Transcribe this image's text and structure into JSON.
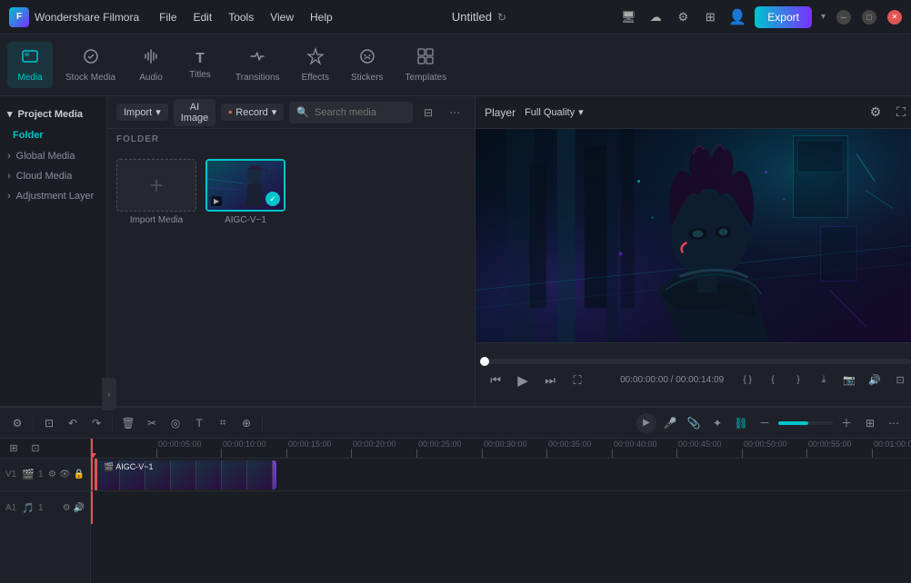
{
  "app": {
    "name": "Wondershare Filmora",
    "logo_letters": "F",
    "doc_title": "Untitled"
  },
  "menu": {
    "items": [
      "File",
      "Edit",
      "Tools",
      "View",
      "Help"
    ]
  },
  "toolbar": {
    "items": [
      {
        "id": "media",
        "label": "Media",
        "icon": "🖼",
        "active": true
      },
      {
        "id": "stock",
        "label": "Stock Media",
        "icon": "🎬",
        "active": false
      },
      {
        "id": "audio",
        "label": "Audio",
        "icon": "♪",
        "active": false
      },
      {
        "id": "titles",
        "label": "Titles",
        "icon": "T",
        "active": false
      },
      {
        "id": "transitions",
        "label": "Transitions",
        "icon": "⟷",
        "active": false
      },
      {
        "id": "effects",
        "label": "Effects",
        "icon": "✦",
        "active": false
      },
      {
        "id": "stickers",
        "label": "Stickers",
        "icon": "★",
        "active": false
      },
      {
        "id": "templates",
        "label": "Templates",
        "icon": "⊞",
        "active": false
      }
    ],
    "export_label": "Export"
  },
  "sidebar": {
    "project_media_label": "Project Media",
    "items": [
      {
        "id": "folder",
        "label": "Folder",
        "active": true
      },
      {
        "id": "global",
        "label": "Global Media",
        "active": false
      },
      {
        "id": "cloud",
        "label": "Cloud Media",
        "active": false
      },
      {
        "id": "adjustment",
        "label": "Adjustment Layer",
        "active": false
      }
    ]
  },
  "media_panel": {
    "import_label": "Import",
    "ai_image_label": "AI Image",
    "record_label": "Record",
    "search_placeholder": "Search media",
    "folder_section": "FOLDER",
    "items": [
      {
        "id": "import",
        "label": "Import Media",
        "type": "add"
      },
      {
        "id": "aigc-v-1",
        "label": "AIGC-V~1",
        "type": "video",
        "selected": true
      }
    ]
  },
  "player": {
    "label": "Player",
    "quality": "Full Quality",
    "current_time": "00:00:00:00",
    "total_time": "00:00:14:09",
    "separator": " / "
  },
  "timeline": {
    "tracks": [
      {
        "id": "video1",
        "type": "video",
        "num": "1",
        "clip": "AIGC-V~1",
        "start_pct": "0",
        "width_pct": "29"
      },
      {
        "id": "audio1",
        "type": "audio",
        "num": "1"
      }
    ],
    "ruler_times": [
      "00:00:05:00",
      "00:00:10:00",
      "00:00:15:00",
      "00:00:20:00",
      "00:00:25:00",
      "00:00:30:00",
      "00:00:35:00",
      "00:00:40:00",
      "00:00:45:00",
      "00:00:50:00",
      "00:00:55:00",
      "00:01:00:00"
    ]
  },
  "icons": {
    "chevron_down": "▾",
    "chevron_right": "›",
    "chevron_left": "‹",
    "plus": "+",
    "check": "✓",
    "filter": "⊟",
    "more": "⋯",
    "search": "🔍",
    "collapse": "‹",
    "play": "▶",
    "pause": "⏸",
    "step_back": "⏮",
    "step_forward": "⏭",
    "fullscreen": "⛶",
    "volume": "🔊",
    "scissors": "✂",
    "undo": "↶",
    "redo": "↷",
    "delete": "🗑",
    "split": "⊢",
    "text": "T",
    "crop": "⌗",
    "target": "◎"
  }
}
